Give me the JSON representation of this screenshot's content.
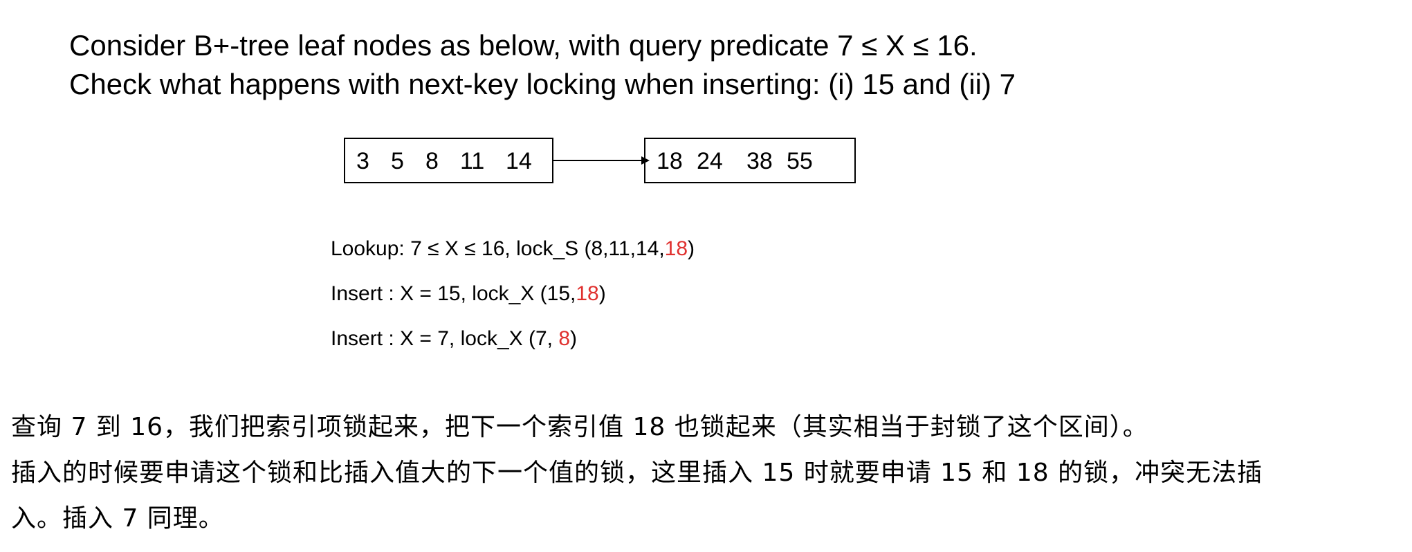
{
  "heading": {
    "line1": "Consider B+-tree leaf nodes as below, with query predicate 7 ≤ X ≤ 16.",
    "line2": "Check what happens with next-key locking when inserting: (i) 15 and (ii) 7"
  },
  "leaf_nodes": [
    {
      "keys": [
        "3",
        "5",
        "8",
        "11",
        "14"
      ]
    },
    {
      "keys": [
        "18",
        "24",
        "38",
        "55"
      ]
    }
  ],
  "locks": [
    {
      "prefix": "Lookup:  7 ≤ X ≤ 16,  lock_S (8,11,14,",
      "next_key": "18",
      "suffix": ")"
    },
    {
      "prefix": "Insert  : X = 15,  lock_X (15,",
      "next_key": "18",
      "suffix": ")"
    },
    {
      "prefix": "Insert  : X = 7,  lock_X (7, ",
      "next_key": "8",
      "suffix": ")"
    }
  ],
  "accent_color": "#e0312f",
  "note": {
    "line1": "查询 7 到 16，我们把索引项锁起来，把下一个索引值 18 也锁起来（其实相当于封锁了这个区间）。",
    "line2": "插入的时候要申请这个锁和比插入值大的下一个值的锁，这里插入 15 时就要申请 15 和 18 的锁，冲突无法插",
    "line3": "入。插入 7 同理。"
  }
}
